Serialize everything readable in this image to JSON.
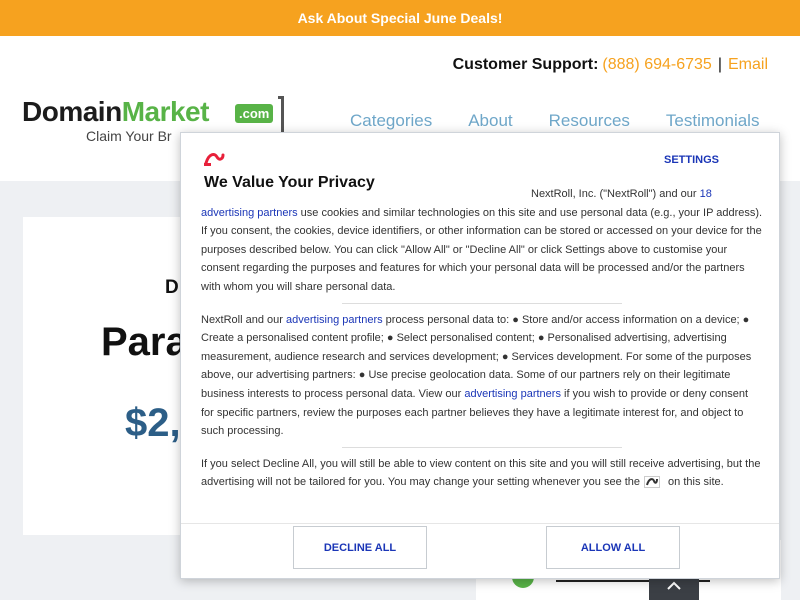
{
  "topbar": {
    "text": "Ask About Special June Deals!"
  },
  "header": {
    "support_label": "Customer Support:",
    "phone": "(888) 694-6735",
    "separator": "|",
    "email": "Email"
  },
  "logo": {
    "part1": "Domain",
    "part2": "Market",
    "tld": ".com",
    "tagline": "Claim Your Br"
  },
  "nav": {
    "items": [
      "Categories",
      "About",
      "Resources",
      "Testimonials"
    ]
  },
  "listing": {
    "label": "D",
    "name": "Para",
    "price": "$2,"
  },
  "modal": {
    "settings": "SETTINGS",
    "title": "We Value Your Privacy",
    "p1a": "NextRoll, Inc. (\"NextRoll\") and our ",
    "p1link": "18 advertising partners",
    "p1b": " use cookies and similar technologies on this site and use personal data (e.g., your IP address). If you consent, the cookies, device identifiers, or other information can be stored or accessed on your device for the purposes described below. You can click \"Allow All\" or \"Decline All\" or click Settings above to customise your consent regarding the purposes and features for which your personal data will be processed and/or the partners with whom you will share personal data.",
    "p2a": "NextRoll and our ",
    "p2link1": "advertising partners",
    "p2b": " process personal data to: ● Store and/or access information on a device; ● Create a personalised content profile; ● Select personalised content; ● Personalised advertising, advertising measurement, audience research and services development; ● Services development. For some of the purposes above, our advertising partners: ● Use precise geolocation data. Some of our partners rely on their legitimate business interests to process personal data. View our ",
    "p2link2": "advertising partners",
    "p2c": " if you wish to provide or deny consent for specific partners, review the purposes each partner believes they have a legitimate interest for, and object to such processing.",
    "p3a": "If you select Decline All, you will still be able to view content on this site and you will still receive advertising, but the advertising will not be tailored for you. You may change your setting whenever you see the",
    "p3b": "on this site.",
    "decline": "DECLINE ALL",
    "allow": "ALLOW ALL"
  },
  "colors": {
    "accent": "#f6a21f",
    "brand_green": "#58b347",
    "link_blue": "#1b36b7",
    "price_blue": "#2c5e87",
    "nextroll_red": "#e8203a"
  },
  "icons": {
    "nextroll_logo": "nextroll-logo-icon",
    "back_to_top": "chevron-up-icon",
    "check": "check-circle-icon"
  }
}
